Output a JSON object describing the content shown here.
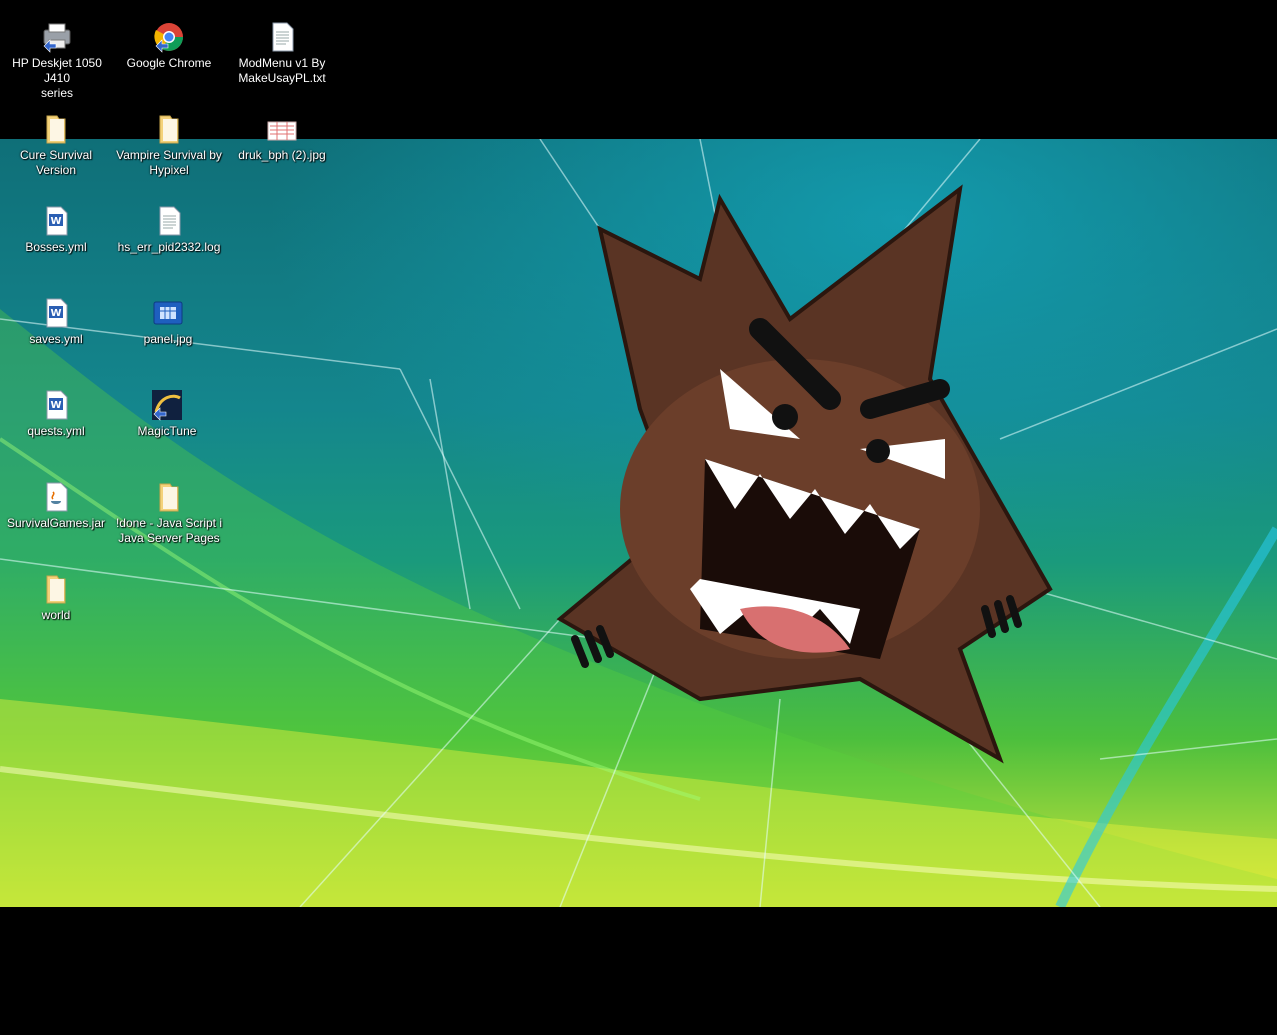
{
  "desktop": {
    "colors": {
      "background": "#000000",
      "label_text": "#ffffff",
      "folder": "#f4d27a",
      "word_blue": "#2b5fb3"
    },
    "icons": [
      {
        "label": "HP Deskjet 1050 J410\nseries",
        "icon": "printer-icon"
      },
      {
        "label": "Google Chrome",
        "icon": "chrome-icon"
      },
      {
        "label": "ModMenu v1 By\nMakeUsayPL.txt",
        "icon": "text-file-icon"
      },
      {
        "label": "Cure Survival\nVersion",
        "icon": "folder-icon"
      },
      {
        "label": "Vampire Survival by\nHypixel",
        "icon": "folder-icon"
      },
      {
        "label": "druk_bph (2).jpg",
        "icon": "image-file-icon"
      },
      {
        "label": "Bosses.yml",
        "icon": "word-document-icon"
      },
      {
        "label": "hs_err_pid2332.log",
        "icon": "text-file-icon"
      },
      {
        "label": "saves.yml",
        "icon": "word-document-icon"
      },
      {
        "label": "panel.jpg",
        "icon": "image-file-icon"
      },
      {
        "label": "quests.yml",
        "icon": "word-document-icon"
      },
      {
        "label": "MagicTune",
        "icon": "magictune-icon"
      },
      {
        "label": "SurvivalGames.jar",
        "icon": "java-file-icon"
      },
      {
        "label": "!done - Java Script i\nJava Server Pages",
        "icon": "folder-icon"
      },
      {
        "label": "world",
        "icon": "folder-icon"
      }
    ]
  }
}
